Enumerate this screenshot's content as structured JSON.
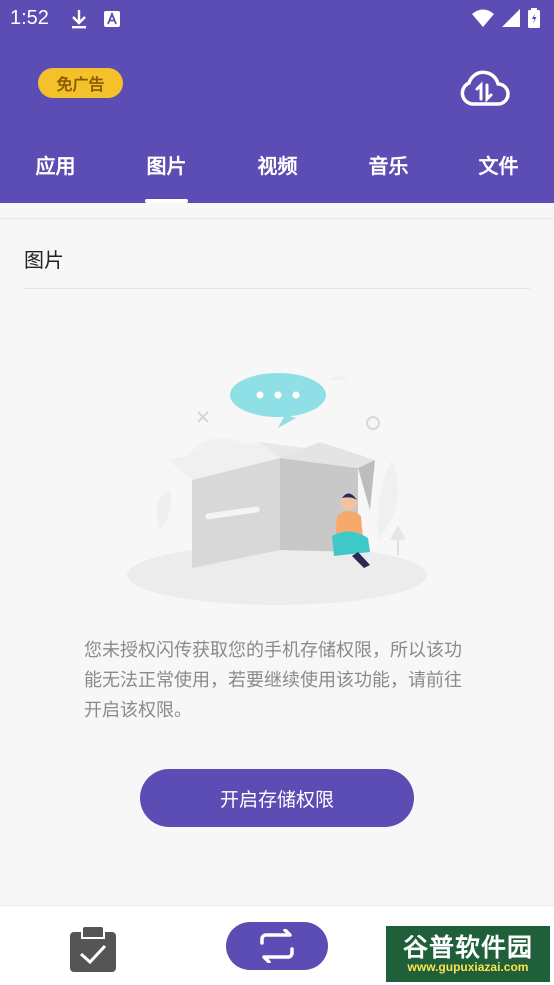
{
  "status_bar": {
    "time": "1:52",
    "icons": [
      "download-icon",
      "a-icon",
      "wifi-icon",
      "signal-icon",
      "battery-icon"
    ]
  },
  "header": {
    "ad_badge": "免广告",
    "cloud_icon": "cloud-transfer-icon",
    "tabs": [
      {
        "label": "应用",
        "active": false
      },
      {
        "label": "图片",
        "active": true
      },
      {
        "label": "视频",
        "active": false
      },
      {
        "label": "音乐",
        "active": false
      },
      {
        "label": "文件",
        "active": false
      }
    ]
  },
  "main": {
    "section_title": "图片",
    "message": "您未授权闪传获取您的手机存储权限，所以该功能无法正常使用，若要继续使用该功能，请前往开启该权限。",
    "grant_button": "开启存储权限"
  },
  "bottom_bar": {
    "left_icon": "clipboard-check-icon",
    "center_icon": "swap-icon",
    "watermark_top": "谷普软件园",
    "watermark_bottom": "www.gupuxiazai.com"
  },
  "colors": {
    "primary": "#5b4db3",
    "badge": "#f5c12b",
    "message_text": "#8a8a8a"
  }
}
